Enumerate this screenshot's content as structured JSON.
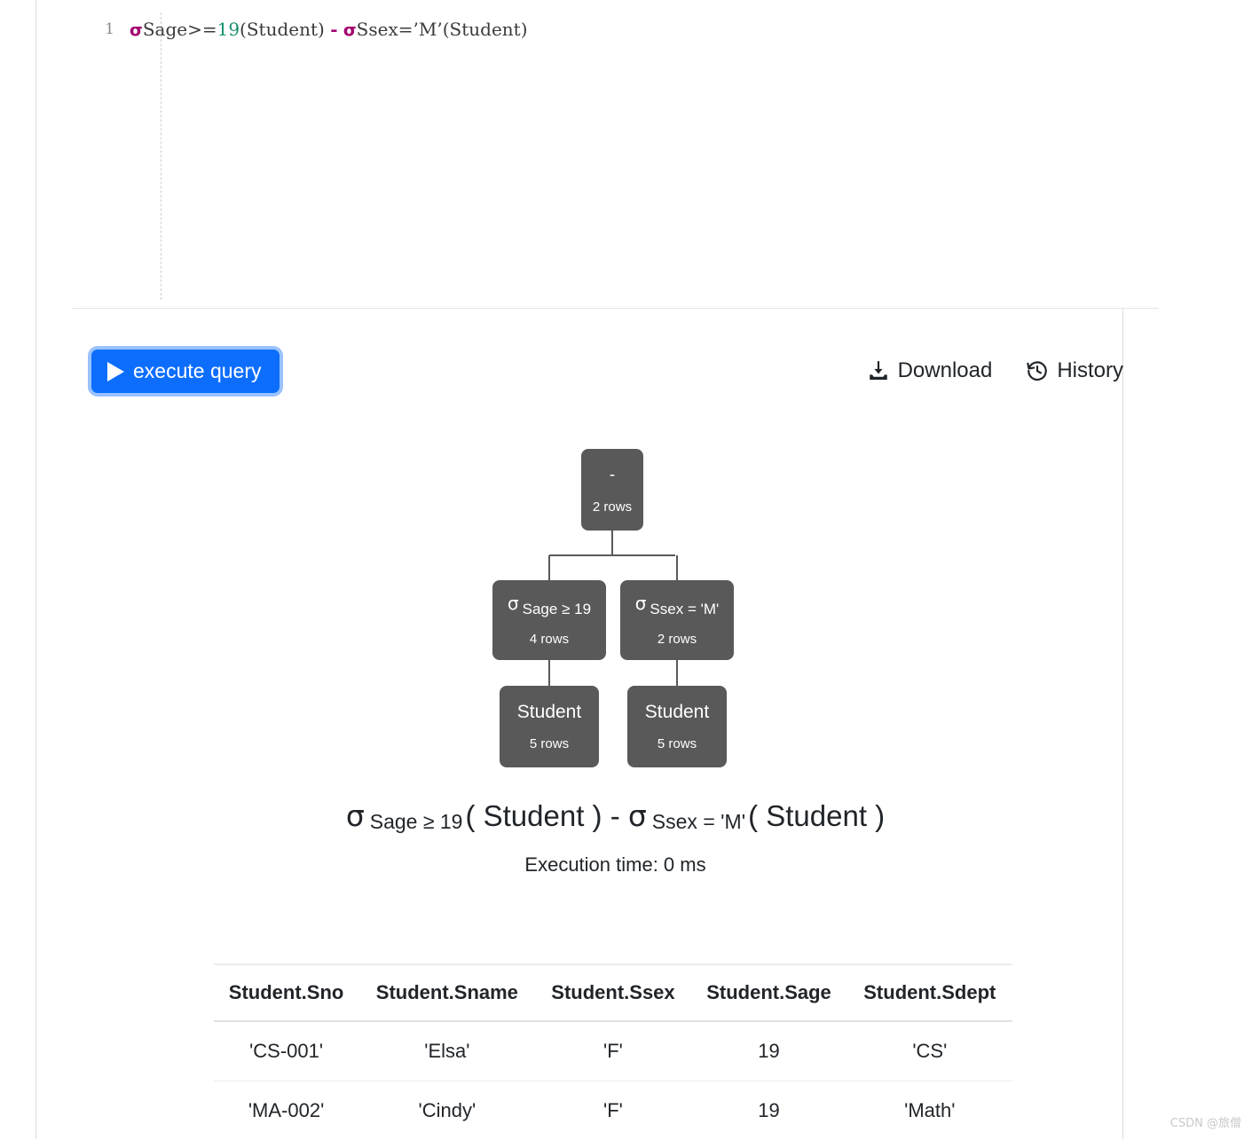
{
  "editor": {
    "line_number": "1",
    "tokens": [
      {
        "t": "sigma",
        "v": "σ"
      },
      {
        "t": "attr",
        "v": "Sage>="
      },
      {
        "t": "num",
        "v": "19"
      },
      {
        "t": "rel",
        "v": "(Student)"
      },
      {
        "t": "space",
        "v": " "
      },
      {
        "t": "op",
        "v": "-"
      },
      {
        "t": "space",
        "v": " "
      },
      {
        "t": "sigma",
        "v": "σ"
      },
      {
        "t": "attr",
        "v": "Ssex="
      },
      {
        "t": "str",
        "v": "’M’"
      },
      {
        "t": "rel",
        "v": "(Student)"
      }
    ],
    "plain_text": "σSage>=19(Student) - σSsex=’M’(Student)"
  },
  "toolbar": {
    "execute_label": "execute query",
    "download_label": "Download",
    "history_label": "History",
    "play_icon": "play-icon",
    "download_icon": "download-icon",
    "history_icon": "history-icon",
    "accent_color": "#0d6efd"
  },
  "tree": {
    "node_color": "#595959",
    "nodes": [
      {
        "id": "root",
        "title": "-",
        "rows": "2 rows",
        "kind": "operator"
      },
      {
        "id": "sel-a",
        "sigma": "σ",
        "cond": "Sage ≥ 19",
        "rows": "4 rows",
        "kind": "selection"
      },
      {
        "id": "sel-b",
        "sigma": "σ",
        "cond": "Ssex = 'M'",
        "rows": "2 rows",
        "kind": "selection"
      },
      {
        "id": "rel-a",
        "title": "Student",
        "rows": "5 rows",
        "kind": "relation"
      },
      {
        "id": "rel-b",
        "title": "Student",
        "rows": "5 rows",
        "kind": "relation"
      }
    ]
  },
  "formula": {
    "sigma1": "σ",
    "cond1": "Sage ≥ 19",
    "rel1": "( Student )",
    "minus": "-",
    "sigma2": "σ",
    "cond2": "Ssex = 'M'",
    "rel2": "( Student )"
  },
  "execution": {
    "time_label": "Execution time: 0 ms"
  },
  "results": {
    "columns": [
      "Student.Sno",
      "Student.Sname",
      "Student.Ssex",
      "Student.Sage",
      "Student.Sdept"
    ],
    "rows": [
      [
        "'CS-001'",
        "'Elsa'",
        "'F'",
        "19",
        "'CS'"
      ],
      [
        "'MA-002'",
        "'Cindy'",
        "'F'",
        "19",
        "'Math'"
      ]
    ]
  },
  "watermark": {
    "text": "CSDN @旅僧"
  }
}
